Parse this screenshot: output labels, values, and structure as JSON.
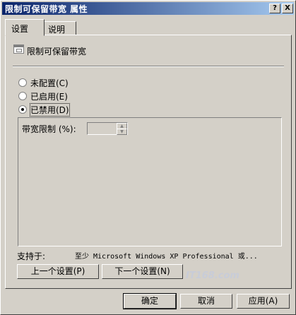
{
  "window": {
    "title": "限制可保留带宽 属性",
    "help_button": "?",
    "close_button": "X"
  },
  "tabs": [
    {
      "label": "设置",
      "active": true
    },
    {
      "label": "说明",
      "active": false
    }
  ],
  "policy": {
    "name": "限制可保留带宽",
    "icon": "policy-icon"
  },
  "options": [
    {
      "label": "未配置(C)",
      "selected": false
    },
    {
      "label": "已启用(E)",
      "selected": false
    },
    {
      "label": "已禁用(D)",
      "selected": true
    }
  ],
  "bandwidth": {
    "label": "带宽限制 (%):",
    "value": ""
  },
  "supported": {
    "label": "支持于:",
    "value": "至少 Microsoft Windows XP Professional 或..."
  },
  "nav": {
    "prev": "上一个设置(P)",
    "next": "下一个设置(N)"
  },
  "footer": {
    "ok": "确定",
    "cancel": "取消",
    "apply": "应用(A)"
  },
  "watermark": "IT168.com"
}
